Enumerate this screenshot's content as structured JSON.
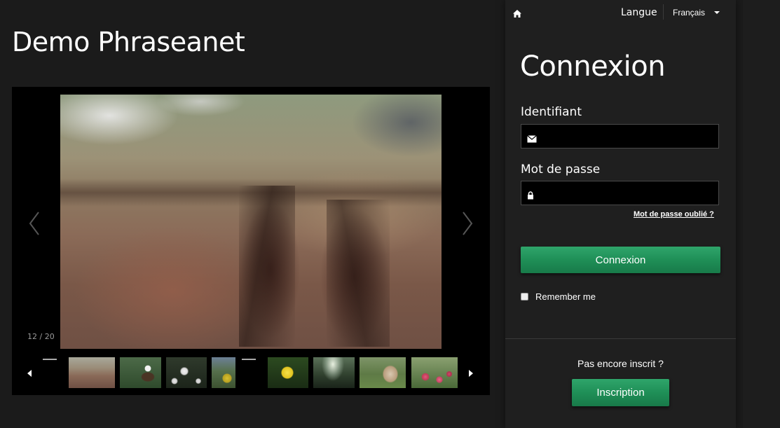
{
  "page": {
    "title": "Demo Phraseanet"
  },
  "carousel": {
    "counter": "12 / 20",
    "thumbnails": [
      {
        "name": "canyon"
      },
      {
        "name": "eagle"
      },
      {
        "name": "white-flowers"
      },
      {
        "name": "yellow-flower-partial"
      },
      {
        "name": "yellow-flower"
      },
      {
        "name": "forest-sunbeams"
      },
      {
        "name": "horse"
      },
      {
        "name": "pink-flowers"
      }
    ]
  },
  "header": {
    "language_label": "Langue",
    "language_selected": "Français"
  },
  "login": {
    "title": "Connexion",
    "username_label": "Identifiant",
    "username_value": "",
    "password_label": "Mot de passe",
    "password_value": "",
    "forgot_password": "Mot de passe oublié ?",
    "submit_label": "Connexion",
    "remember_me": "Remember me"
  },
  "signup": {
    "prompt": "Pas encore inscrit ?",
    "button_label": "Inscription"
  },
  "colors": {
    "background": "#1b1b1b",
    "panel": "#1f1f1f",
    "accent_green": "#1f8f57"
  }
}
